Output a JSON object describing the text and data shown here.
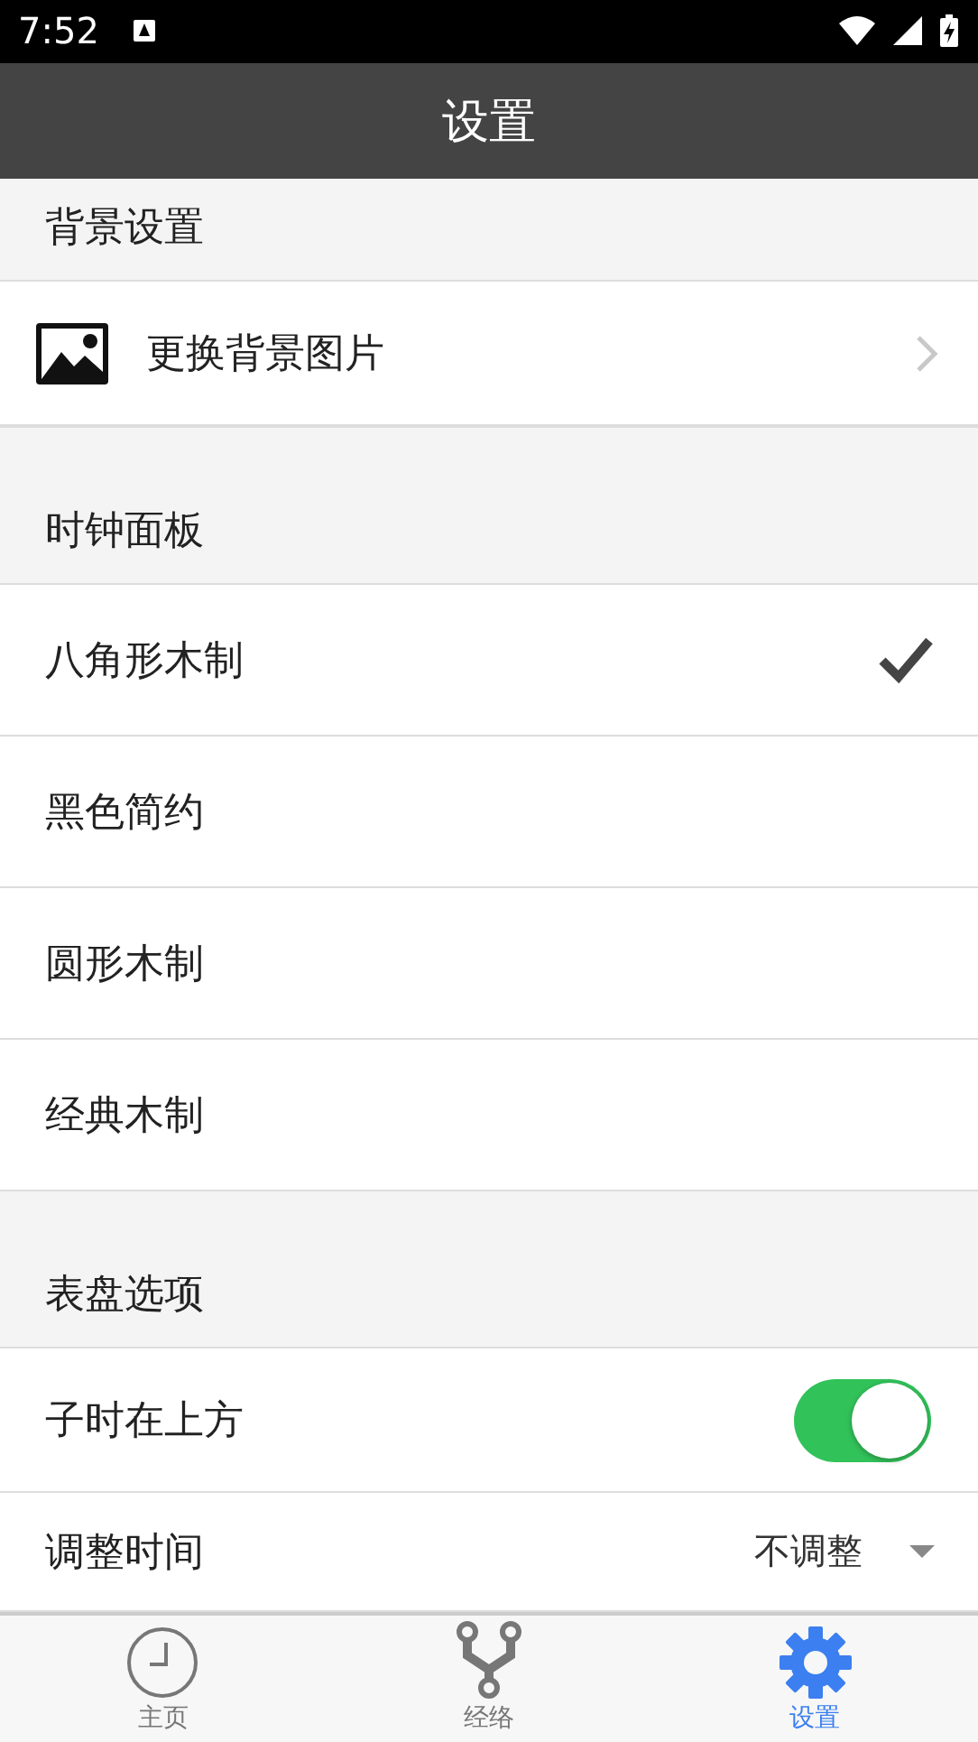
{
  "status_bar": {
    "time": "7:52"
  },
  "title": "设置",
  "sections": [
    {
      "header": "背景设置",
      "items": [
        {
          "kind": "link",
          "label": "更换背景图片"
        }
      ]
    },
    {
      "header": "时钟面板",
      "items": [
        {
          "kind": "choice",
          "label": "八角形木制",
          "selected": true
        },
        {
          "kind": "choice",
          "label": "黑色简约",
          "selected": false
        },
        {
          "kind": "choice",
          "label": "圆形木制",
          "selected": false
        },
        {
          "kind": "choice",
          "label": "经典木制",
          "selected": false
        }
      ]
    },
    {
      "header": "表盘选项",
      "items": [
        {
          "kind": "toggle",
          "label": "子时在上方",
          "on": true
        },
        {
          "kind": "dropdown",
          "label": "调整时间",
          "value": "不调整"
        }
      ]
    }
  ],
  "tabs": [
    {
      "kind": "clock",
      "label": "主页",
      "selected": false
    },
    {
      "kind": "branch",
      "label": "经络",
      "selected": false
    },
    {
      "kind": "gear",
      "label": "设置",
      "selected": true
    }
  ]
}
